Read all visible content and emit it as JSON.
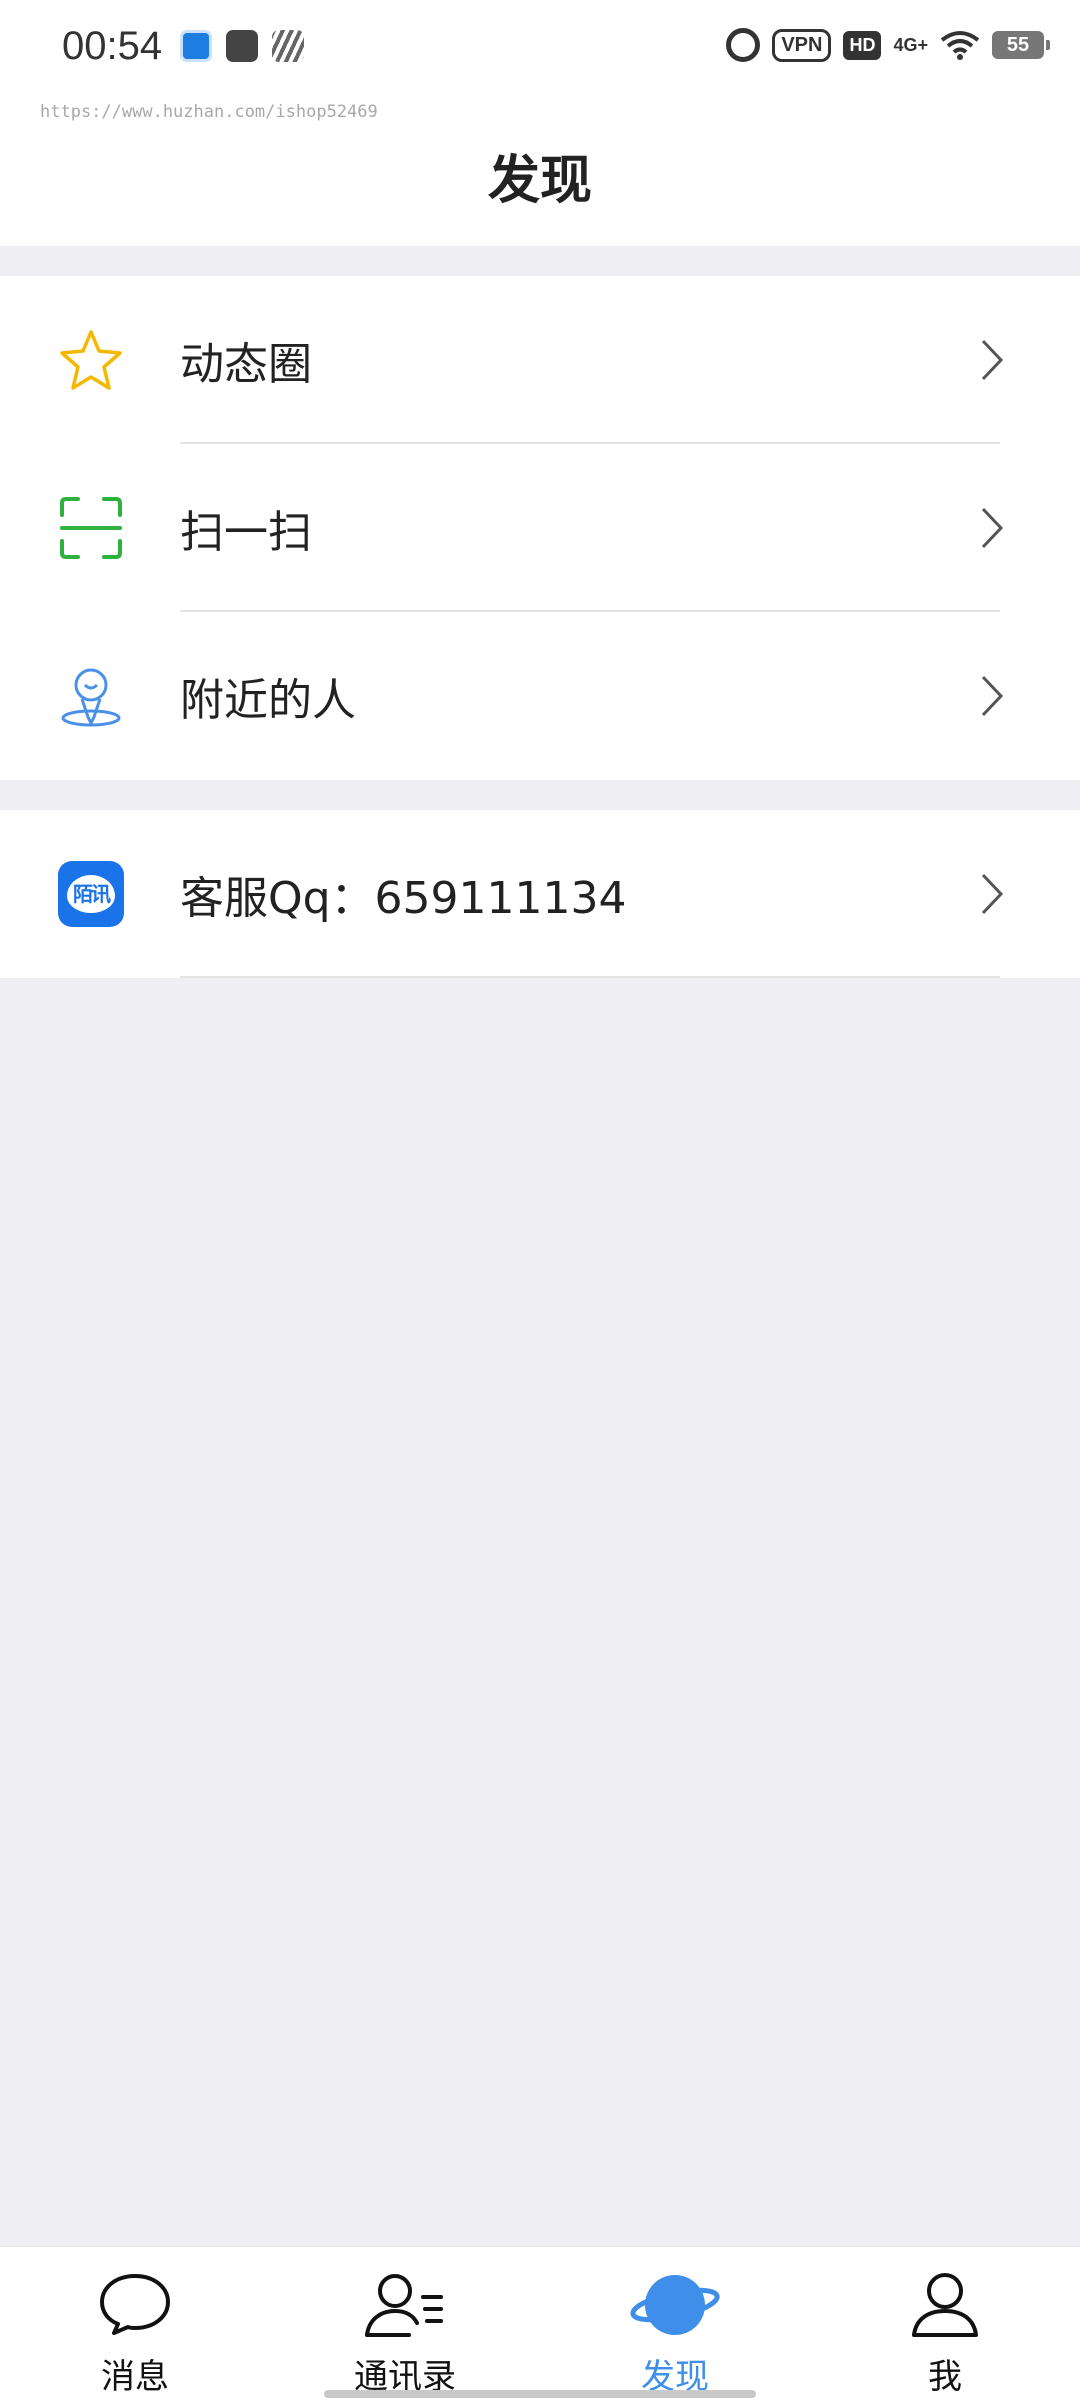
{
  "status_bar": {
    "time": "00:54",
    "vpn": "VPN",
    "hd": "HD",
    "network": "4G+",
    "battery": "55"
  },
  "watermark": "https://www.huzhan.com/ishop52469",
  "header": {
    "title": "发现"
  },
  "groups": [
    {
      "items": [
        {
          "label": "动态圈",
          "icon": "star-icon",
          "color": "#f5b800"
        },
        {
          "label": "扫一扫",
          "icon": "scan-icon",
          "color": "#2db33d"
        },
        {
          "label": "附近的人",
          "icon": "nearby-person-icon",
          "color": "#4a8fe8"
        }
      ]
    },
    {
      "items": [
        {
          "label": "客服Qq：659111134",
          "icon": "app-logo-icon",
          "logo_text": "陌讯",
          "color": "#1a73e8"
        }
      ]
    }
  ],
  "tabbar": {
    "tabs": [
      {
        "label": "消息",
        "icon": "chat-bubble-icon",
        "active": false
      },
      {
        "label": "通讯录",
        "icon": "contacts-icon",
        "active": false
      },
      {
        "label": "发现",
        "icon": "planet-icon",
        "active": true
      },
      {
        "label": "我",
        "icon": "person-icon",
        "active": false
      }
    ],
    "active_color": "#3f8ee9"
  },
  "colors": {
    "background": "#eeeef3",
    "surface": "#ffffff",
    "accent": "#3f8ee9"
  }
}
